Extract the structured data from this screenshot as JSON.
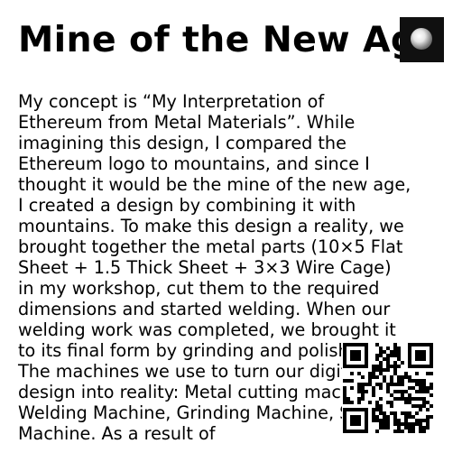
{
  "post": {
    "title": "Mine of the New Age",
    "description": "My concept is “My Interpretation of Ethereum from Metal Materials”. While imagining this design, I compared the Ethereum logo to mountains, and since I thought it would be the mine of the new age, I created a design by combining it with mountains. To make this design a reality, we brought together the metal parts (10×5 Flat Sheet + 1.5 Thick Sheet + 3×3 Wire Cage) in my workshop, cut them to the required dimensions and started welding. When our welding work was completed, we brought it to its final form by grinding and polishing. The machines we use to turn our digital design into reality: Metal cutting machine, Welding Machine, Grinding Machine, Sanding Machine. As a result of"
  },
  "icons": {
    "badge": "glossy-sphere-icon",
    "qr": "qr-code-icon"
  }
}
